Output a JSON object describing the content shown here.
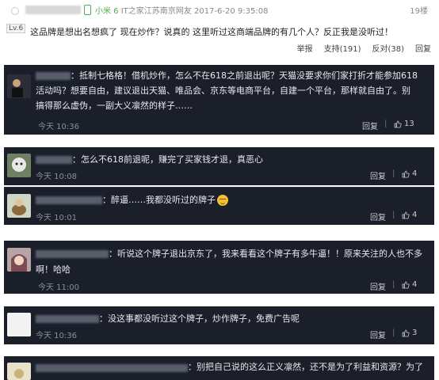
{
  "header_post": {
    "device": "小米 6",
    "meta": "IT之家江苏南京网友 2017-6-20 9:35:08",
    "floor": "19楼",
    "level": "Lv.6",
    "content": "这品牌是想出名想疯了 现在炒作？说真的 这里听过这商端品牌的有几个人？反正我是没听过！",
    "actions": {
      "report": "举报",
      "support": "支持(191)",
      "oppose": "反对(38)",
      "reply": "回复"
    }
  },
  "comments": [
    {
      "lines": [
        "：抵制七格格！借机炒作，怎么不在618之前退出呢？天猫没要求你们家打折才能参加618",
        "活动吗？想要自由，建议退出天猫、唯品会、京东等电商平台，自建一个平台，那样就自由了。别",
        "搞得那么虚伪，一副大义凛然的样子……"
      ],
      "time": "今天 10:36",
      "reply": "回复",
      "likes": "13"
    },
    {
      "lines": [
        "：怎么不618前退呢，赚完了买家钱才退，真恶心"
      ],
      "time": "今天 10:08",
      "reply": "回复",
      "likes": "4"
    },
    {
      "lines": [
        "：醉逼……我都没听过的牌子"
      ],
      "time": "今天 10:01",
      "reply": "回复",
      "likes": "4"
    },
    {
      "lines": [
        "：听说这个牌子退出京东了，我来看看这个牌子有多牛逼！！原来关注的人也不多",
        "啊！哈哈"
      ],
      "time": "今天 11:00",
      "reply": "回复",
      "likes": "4"
    },
    {
      "lines": [
        "：没这事都没听过这个牌子，炒作牌子，免费广告呢"
      ],
      "time": "今天 10:36",
      "reply": "回复",
      "likes": "3"
    },
    {
      "lines": [
        "：别把自己说的这么正义凛然，还不是为了利益和资源？为了"
      ],
      "time": "",
      "reply": "",
      "likes": ""
    }
  ]
}
